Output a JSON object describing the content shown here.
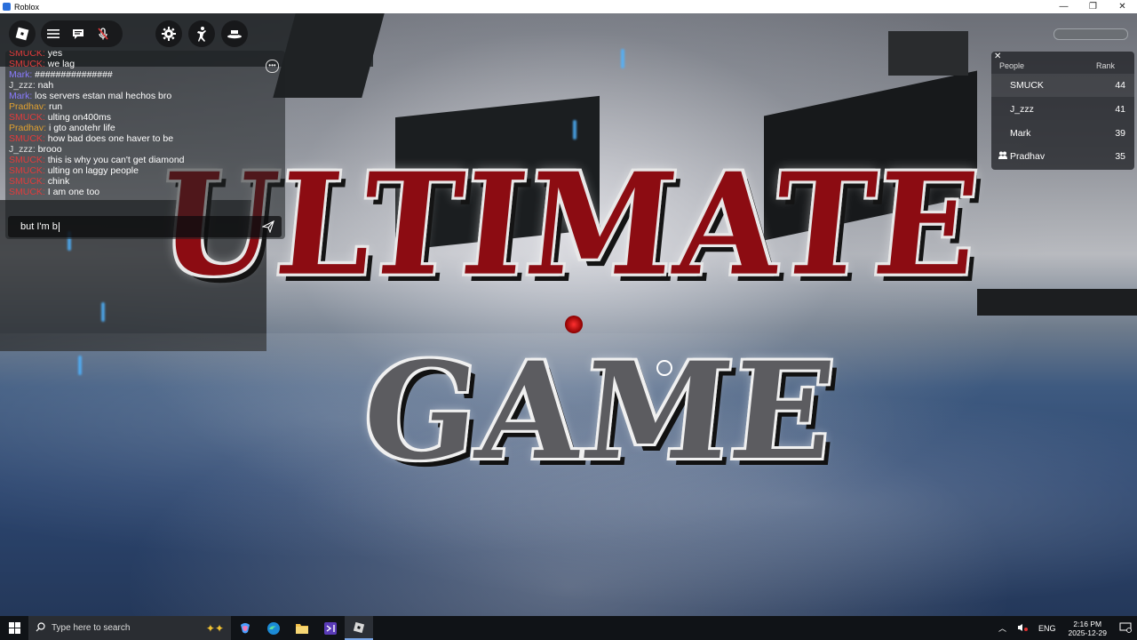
{
  "window": {
    "title": "Roblox",
    "controls": {
      "minimize": "—",
      "restore": "❐",
      "close": "✕"
    }
  },
  "toolbar": {
    "roblox_icon": "roblox-logo-icon",
    "menu_icon": "hamburger-menu-icon",
    "chat_icon": "chat-bubble-icon",
    "mic_icon": "microphone-muted-icon",
    "settings_icon": "gear-icon",
    "emote_icon": "emote-figure-icon",
    "hat_icon": "hat-icon"
  },
  "chat": {
    "messages": [
      {
        "name": "SMUCK:",
        "text": " yes",
        "color": "#e23b3b"
      },
      {
        "name": "SMUCK:",
        "text": " we lag",
        "color": "#e23b3b"
      },
      {
        "name": "Mark:",
        "text": " ###############",
        "color": "#8a7cff"
      },
      {
        "name": "J_zzz:",
        "text": " nah",
        "color": "#e0e0e0"
      },
      {
        "name": "Mark:",
        "text": " los servers estan mal hechos bro",
        "color": "#8a7cff"
      },
      {
        "name": "Pradhav:",
        "text": " run",
        "color": "#e0a030"
      },
      {
        "name": "SMUCK:",
        "text": " ulting on400ms",
        "color": "#e23b3b"
      },
      {
        "name": "Pradhav:",
        "text": " i gto anotehr life",
        "color": "#e0a030"
      },
      {
        "name": "SMUCK:",
        "text": " how bad does one haver to be",
        "color": "#e23b3b"
      },
      {
        "name": "J_zzz:",
        "text": " brooo",
        "color": "#e0e0e0"
      },
      {
        "name": "SMUCK:",
        "text": " this is why you can't get diamond",
        "color": "#e23b3b"
      },
      {
        "name": "SMUCK:",
        "text": " ulting on laggy people",
        "color": "#e23b3b"
      },
      {
        "name": "SMUCK:",
        "text": " chink",
        "color": "#e23b3b"
      },
      {
        "name": "SMUCK:",
        "text": " I am one too",
        "color": "#e23b3b"
      }
    ],
    "input_value": "but I'm b",
    "more_icon": "more-options-icon",
    "send_icon": "send-icon"
  },
  "leaderboard": {
    "close": "✕",
    "col_people": "People",
    "col_rank": "Rank",
    "rows": [
      {
        "name": "SMUCK",
        "rank": "44"
      },
      {
        "name": "J_zzz",
        "rank": "41"
      },
      {
        "name": "Mark",
        "rank": "39"
      },
      {
        "name": "Pradhav",
        "rank": "35"
      }
    ]
  },
  "title_art": {
    "line1": "ULTIMATE",
    "line2": "GAME"
  },
  "taskbar": {
    "search_placeholder": "Type here to search",
    "lang": "ENG",
    "time": "2:16 PM",
    "date": "2025-12-29"
  }
}
